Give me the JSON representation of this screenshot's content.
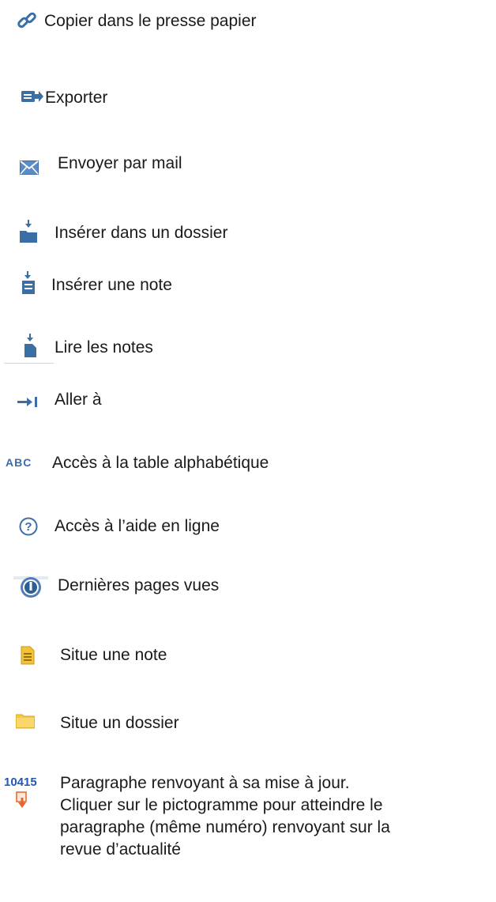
{
  "items": [
    {
      "icon": "link-icon",
      "label": "Copier dans le presse papier"
    },
    {
      "icon": "export-icon",
      "label": "Exporter"
    },
    {
      "icon": "envelope-icon",
      "label": "Envoyer par mail"
    },
    {
      "icon": "folder-insert-icon",
      "label": "Insérer dans un dossier"
    },
    {
      "icon": "note-insert-icon",
      "label": "Insérer une note"
    },
    {
      "icon": "note-read-icon",
      "label": "Lire les notes"
    },
    {
      "icon": "go-to-icon",
      "label": "Aller à"
    },
    {
      "icon": "abc-icon",
      "label": "Accès à la table alphabétique"
    },
    {
      "icon": "help-icon",
      "label": "Accès à l’aide en ligne"
    },
    {
      "icon": "history-icon",
      "label": "Dernières pages vues"
    },
    {
      "icon": "note-locate-icon",
      "label": "Situe une note"
    },
    {
      "icon": "folder-locate-icon",
      "label": "Situe un dossier"
    }
  ],
  "update_paragraph": {
    "number": "10415",
    "line1": "Paragraphe renvoyant à sa mise à jour.",
    "line2": "Cliquer sur le pictogramme pour atteindre le",
    "line3": "paragraphe (même numéro) renvoyant sur la",
    "line4": "revue d’actualité"
  },
  "colors": {
    "icon_blue": "#3a6ea5",
    "number_blue": "#1f58b8",
    "note_yellow": "#f2c23a",
    "folder_yellow": "#f5c842",
    "arrow_orange": "#e8642a"
  }
}
